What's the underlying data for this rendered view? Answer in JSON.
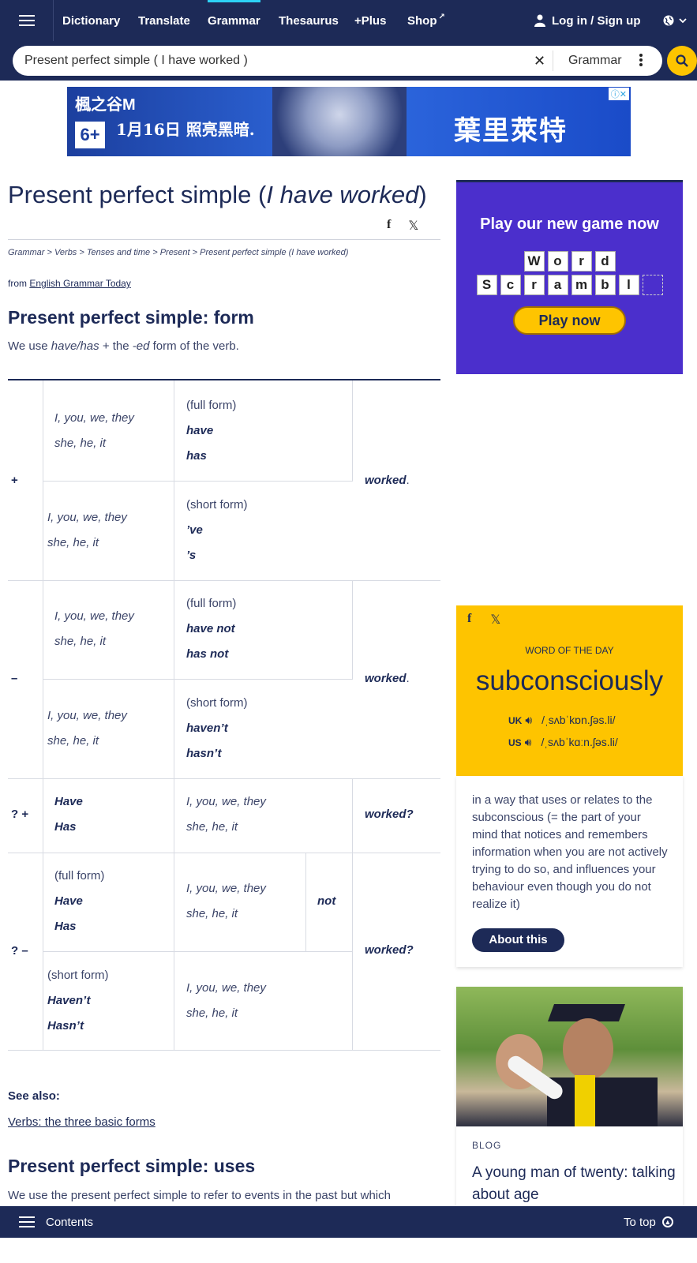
{
  "nav": {
    "links": [
      "Dictionary",
      "Translate",
      "Grammar",
      "Thesaurus",
      "+Plus",
      "Shop"
    ],
    "login_label": "Log in / Sign up"
  },
  "search": {
    "value": "Present perfect simple ( I have worked )",
    "dataset": "Grammar"
  },
  "ad": {
    "logo": "楓之谷M",
    "rating": "6+",
    "date": "1月16日 照亮黑暗.",
    "name": "葉里萊特"
  },
  "article": {
    "title_start": "Present perfect simple (",
    "title_italic": "I have worked",
    "title_end": ")",
    "breadcrumb": "Grammar > Verbs > Tenses and time > Present > Present perfect simple (I have worked)",
    "source_prefix": "from",
    "source_link": "English Grammar Today",
    "heading_form": "Present perfect simple: form",
    "intro_1": "We use",
    "intro_2": "have/has",
    "intro_3": "+ the",
    "intro_4": "-ed",
    "intro_5": "form of the verb.",
    "see_also_label": "See also:",
    "see_also_link": "Verbs: the three basic forms",
    "heading_uses": "Present perfect simple: uses",
    "uses_text": "We use the present perfect simple to refer to events in the past but which"
  },
  "table": {
    "signs": [
      "+",
      "–",
      "? +",
      "? –"
    ],
    "pronouns_plural": "I, you, we, they",
    "pronouns_singular": "she, he, it",
    "full_form": "(full form)",
    "short_form": "(short form)",
    "pos_full": [
      "have",
      "has"
    ],
    "pos_short": [
      "’ve",
      "’s"
    ],
    "neg_full": [
      "have not",
      "has not"
    ],
    "neg_short": [
      "haven’t",
      "hasn’t"
    ],
    "q_pos": [
      "Have",
      "Has"
    ],
    "q_neg_full": [
      "Have",
      "Has"
    ],
    "q_neg_short": [
      "Haven’t",
      "Hasn’t"
    ],
    "not_word": "not",
    "worked": "worked",
    "worked_q": "worked?"
  },
  "game_ad": {
    "title": "Play our new game now",
    "row1": [
      "W",
      "o",
      "r",
      "d"
    ],
    "row2": [
      "S",
      "c",
      "r",
      "a",
      "m",
      "b",
      "l",
      ""
    ],
    "button": "Play now"
  },
  "wotd": {
    "label": "WORD OF THE DAY",
    "word": "subconsciously",
    "uk_label": "UK",
    "uk_ipa": "/ˌsʌbˈkɒn.ʃəs.li/",
    "us_label": "US",
    "us_ipa": "/ˌsʌbˈkɑːn.ʃəs.li/",
    "definition": "in a way that uses or relates to the subconscious (= the part of your mind that notices and remembers information when you are not actively trying to do so, and influences your behaviour even though you do not realize it)",
    "about_button": "About this"
  },
  "blog": {
    "label": "BLOG",
    "title": "A young man of twenty: talking about age"
  },
  "bottom": {
    "contents": "Contents",
    "to_top": "To top"
  },
  "colors": {
    "navy": "#1d2a57",
    "accent_yellow": "#fec400",
    "active_tab": "#2dd2f5",
    "game_purple": "#4b2fcc"
  }
}
